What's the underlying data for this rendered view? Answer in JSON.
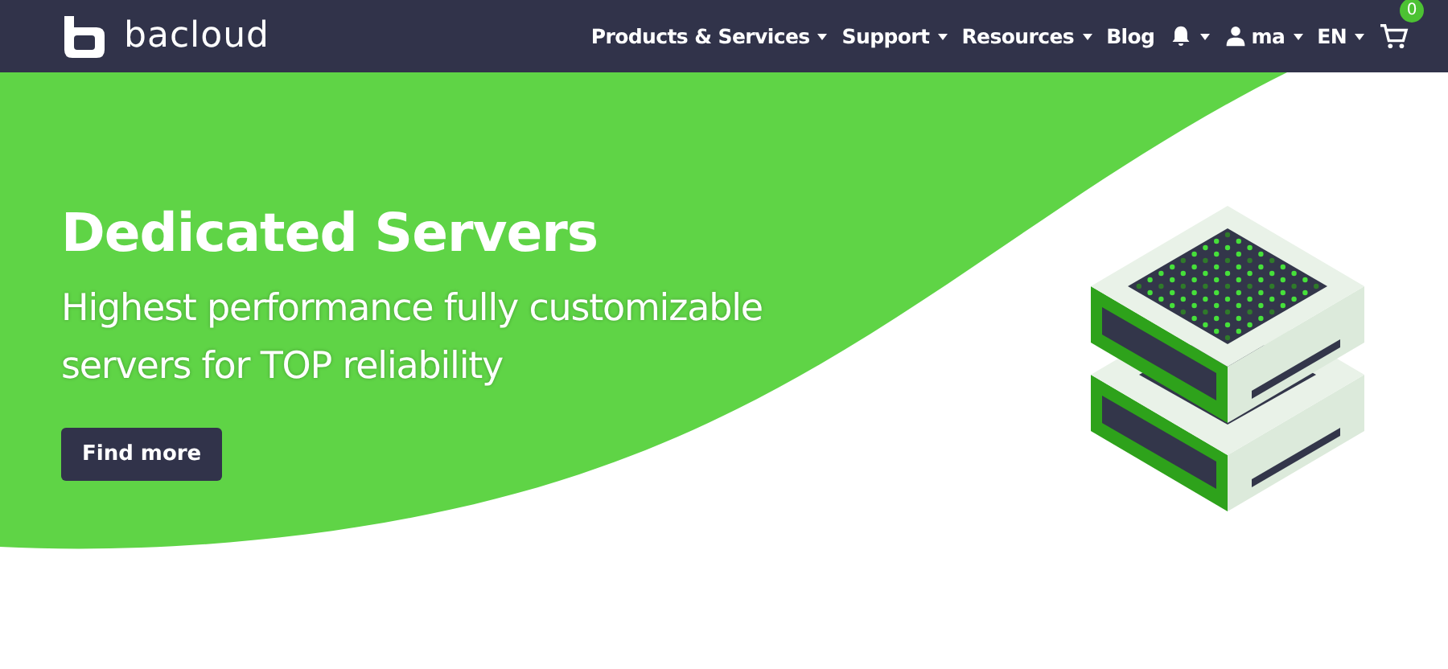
{
  "brand": {
    "name": "bacloud"
  },
  "nav": [
    {
      "kind": "link",
      "label": "Products & Services",
      "dropdown": true
    },
    {
      "kind": "link",
      "label": "Support",
      "dropdown": true
    },
    {
      "kind": "link",
      "label": "Resources",
      "dropdown": true
    },
    {
      "kind": "link",
      "label": "Blog",
      "dropdown": false
    },
    {
      "kind": "bell",
      "dropdown": true
    },
    {
      "kind": "user",
      "label": "ma",
      "dropdown": true
    },
    {
      "kind": "link",
      "label": "EN",
      "dropdown": true
    },
    {
      "kind": "cart",
      "badge": "0"
    }
  ],
  "hero": {
    "title": "Dedicated Servers",
    "subtitle": "Highest performance fully customizable servers for TOP reliability",
    "button": "Find more"
  }
}
